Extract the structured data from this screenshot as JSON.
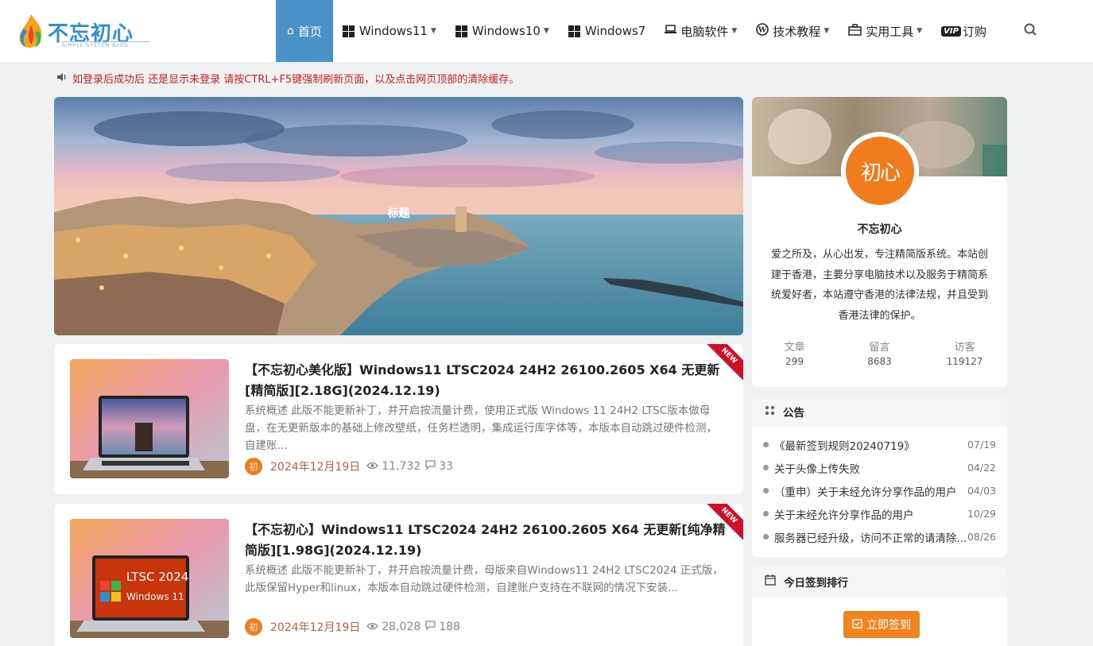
{
  "header": {
    "logo_text": "不忘初心",
    "logo_sub": "SIMPLE SYSTEM BLOG",
    "nav": [
      {
        "label": "首页",
        "icon": "home-icon"
      },
      {
        "label": "Windows11",
        "icon": "windows-icon"
      },
      {
        "label": "Windows10",
        "icon": "windows-icon"
      },
      {
        "label": "Windows7",
        "icon": "windows-icon"
      },
      {
        "label": "电脑软件",
        "icon": "laptop-icon"
      },
      {
        "label": "技术教程",
        "icon": "wordpress-icon"
      },
      {
        "label": "实用工具",
        "icon": "briefcase-icon"
      },
      {
        "label": "订购",
        "icon": "vip-icon",
        "badge": "VIP"
      }
    ]
  },
  "notice_bar": "如登录后成功后 还是显示未登录 请按CTRL+F5键强制刷新页面，以及点击网页顶部的清除缓存。",
  "banner": {
    "title": "标题"
  },
  "posts": [
    {
      "title": "【不忘初心美化版】Windows11 LTSC2024 24H2 26100.2605 X64 无更新[精简版][2.18G](2024.12.19)",
      "excerpt": "系统概述 此版不能更新补丁，并开启按流量计费，使用正式版 Windows 11 24H2 LTSC版本做母盘，在无更新版本的基础上修改壁纸，任务栏透明，集成运行库字体等，本版本自动跳过硬件检测，自建账...",
      "date": "2024年12月19日",
      "views": "11,732",
      "comments": "33",
      "ribbon": "NEW"
    },
    {
      "title": "【不忘初心】Windows11 LTSC2024 24H2 26100.2605 X64 无更新[纯净精简版][1.98G](2024.12.19)",
      "excerpt": "系统概述 此版不能更新补丁，并开启按流量计费，母版来自Windows11 24H2 LTSC2024 正式版，此版保留Hyper和linux，本版本自动跳过硬件检测，自建账户支持在不联网的情况下安装...",
      "date": "2024年12月19日",
      "views": "28,028",
      "comments": "188",
      "ribbon": "NEW",
      "thumb_text_1": "LTSC 2024",
      "thumb_text_2": "Windows 11"
    }
  ],
  "profile": {
    "avatar_text": "初心",
    "name": "不忘初心",
    "desc": "爱之所及，从心出发，专注精简版系统。本站创建于香港，主要分享电脑技术以及服务于精简系统爱好者，本站遵守香港的法律法规，并且受到香港法律的保护。",
    "stats": [
      {
        "label": "文章",
        "value": "299"
      },
      {
        "label": "留言",
        "value": "8683"
      },
      {
        "label": "访客",
        "value": "119127"
      }
    ]
  },
  "announcements": {
    "title": "公告",
    "items": [
      {
        "text": "《最新签到规则20240719》",
        "date": "07/19"
      },
      {
        "text": "关于头像上传失败",
        "date": "04/22"
      },
      {
        "text": "（重申）关于未经允许分享作品的用户",
        "date": "04/03"
      },
      {
        "text": "关于未经允许分享作品的用户",
        "date": "10/29"
      },
      {
        "text": "服务器已经升级，访问不正常的请清除...",
        "date": "08/26"
      }
    ]
  },
  "signin": {
    "title": "今日签到排行",
    "button": "立即签到"
  },
  "colors": {
    "accent": "#4a90c9",
    "orange": "#f2841f",
    "notice_red": "#d02020"
  }
}
